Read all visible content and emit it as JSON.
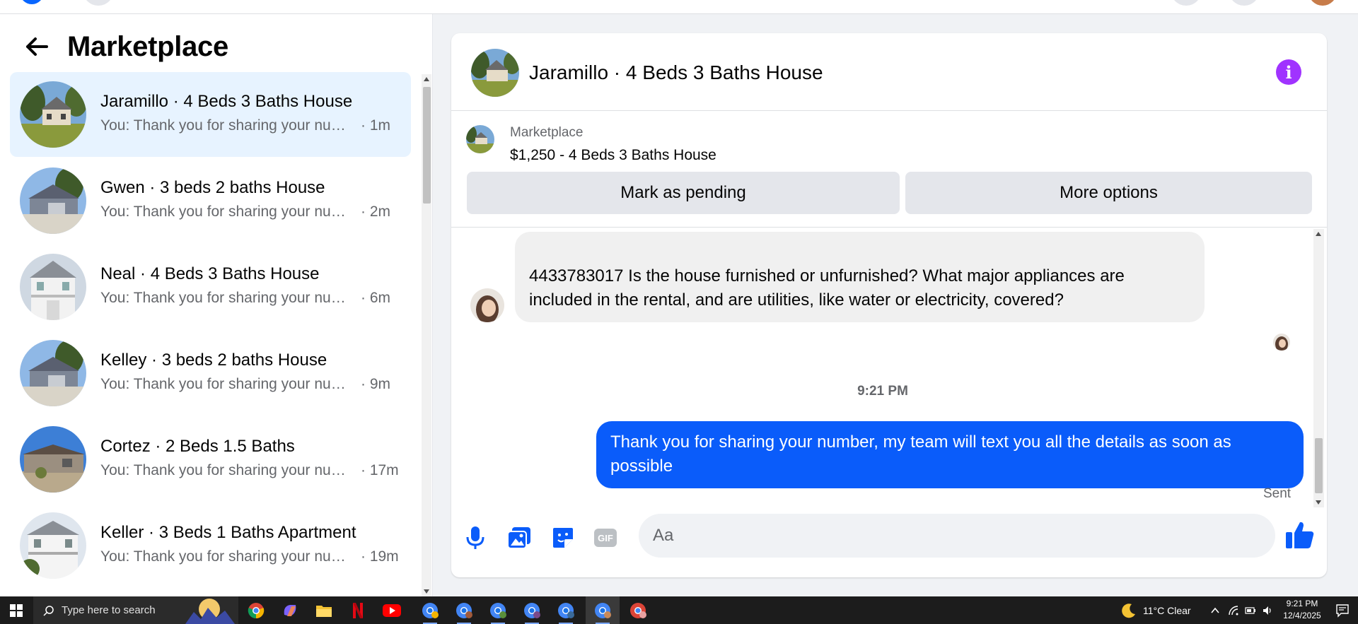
{
  "panel": {
    "title": "Marketplace",
    "back_label": "Back"
  },
  "conversations": [
    {
      "name": "Jaramillo · 4 Beds 3 Baths House",
      "preview": "You: Thank you for sharing your number, my team will text you all the details as soon as possible",
      "time": "1m"
    },
    {
      "name": "Gwen · 3 beds 2 baths House",
      "preview": "You: Thank you for sharing your number, my team will text you all the details as soon as possible",
      "time": "2m"
    },
    {
      "name": "Neal · 4 Beds 3 Baths House",
      "preview": "You: Thank you for sharing your number, my team will text you all the details as soon as possible",
      "time": "6m"
    },
    {
      "name": "Kelley · 3 beds 2 baths House",
      "preview": "You: Thank you for sharing your number, my team will text you all the details as soon as possible",
      "time": "9m"
    },
    {
      "name": "Cortez · 2 Beds 1.5 Baths",
      "preview": "You: Thank you for sharing your number, my team will text you all the details as soon as possible",
      "time": "17m"
    },
    {
      "name": "Keller · 3 Beds 1 Baths Apartment",
      "preview": "You: Thank you for sharing your number, my team will text you all the details as soon as possible",
      "time": "19m"
    }
  ],
  "chat": {
    "title": "Jaramillo · 4 Beds 3 Baths House",
    "listing_label": "Marketplace",
    "listing_price": "$1,250 - 4 Beds 3 Baths House",
    "mark_pending_label": "Mark as pending",
    "more_options_label": "More options",
    "incoming_message": "4433783017 Is the house furnished or unfurnished? What major appliances are included in the rental, and are utilities, like water or electricity, covered?",
    "timestamp": "9:21 PM",
    "outgoing_message": "Thank you for  sharing your number, my team will text you all the details as soon as possible",
    "status": "Sent",
    "input_placeholder": "Aa"
  },
  "taskbar": {
    "search_placeholder": "Type here to search",
    "weather": "11°C  Clear",
    "time": "9:21 PM",
    "date": "12/4/2025"
  },
  "colors": {
    "accent_blue": "#0a5cfa",
    "info_purple": "#a033ff",
    "active_conv_bg": "#e7f3ff"
  }
}
